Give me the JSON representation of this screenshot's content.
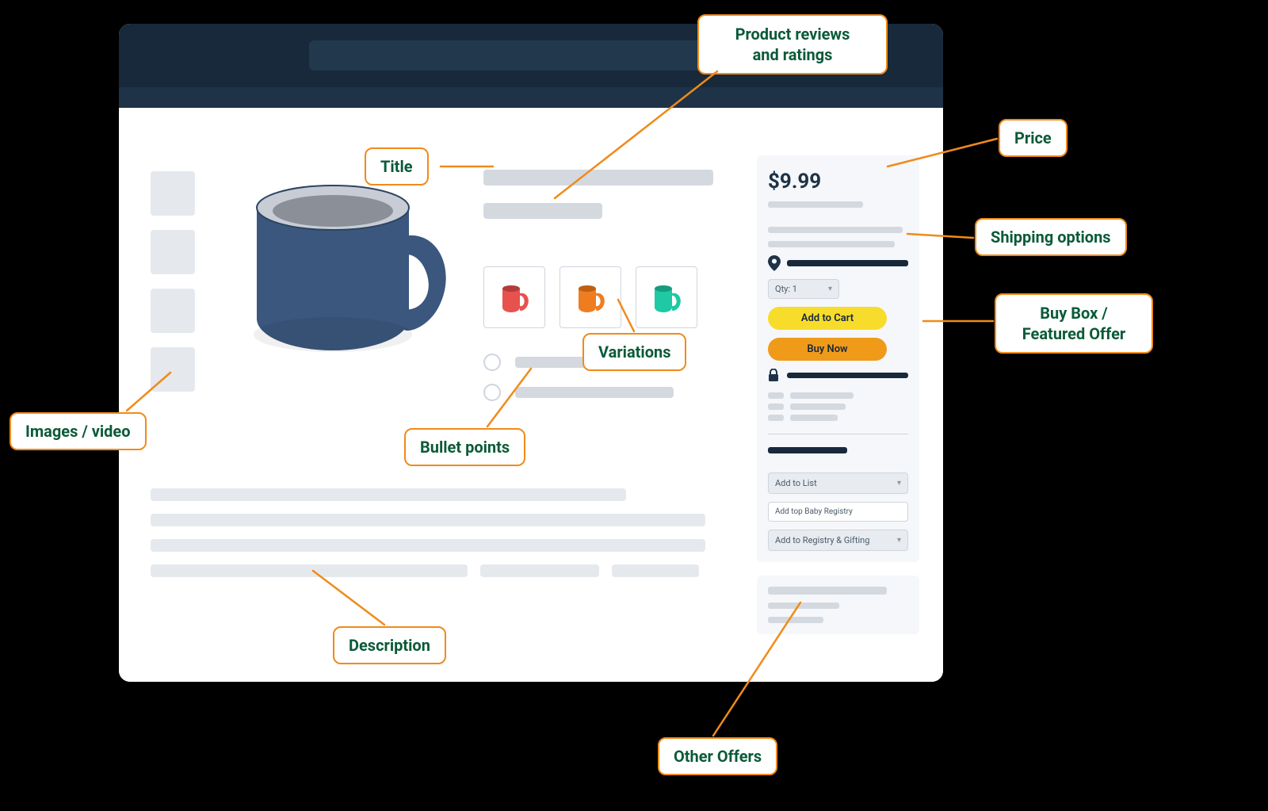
{
  "callouts": {
    "reviews": "Product reviews\nand ratings",
    "price": "Price",
    "shipping": "Shipping options",
    "buybox": "Buy Box /\nFeatured Offer",
    "title": "Title",
    "variations": "Variations",
    "images": "Images / video",
    "bullets": "Bullet points",
    "description": "Description",
    "other_offers": "Other Offers"
  },
  "buybox": {
    "price": "$9.99",
    "qty_label": "Qty: 1",
    "add_to_cart": "Add to Cart",
    "buy_now": "Buy Now",
    "add_to_list": "Add to List",
    "baby_registry": "Add top Baby Registry",
    "registry_gifting": "Add to Registry & Gifting"
  },
  "variation_colors": {
    "main": "#3b577d",
    "red": "#e7524e",
    "orange": "#ee7d21",
    "teal": "#1fc9a3"
  }
}
